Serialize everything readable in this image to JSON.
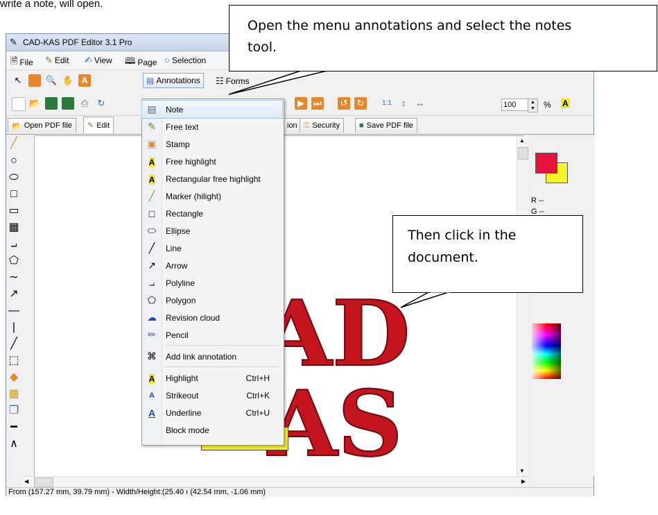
{
  "intro_text": "write a note,  will open.",
  "window": {
    "title": "CAD-KAS PDF Editor 3.1 Pro",
    "menu": [
      "File",
      "Edit",
      "View",
      "Page",
      "Selection"
    ]
  },
  "toolbar": {
    "annotations_label": "Annotations",
    "forms_label": "Forms",
    "zoom_value": "100",
    "zoom_unit": "%"
  },
  "tabs": [
    {
      "label": "Open PDF file"
    },
    {
      "label": "Edit"
    },
    {
      "label": "Security"
    },
    {
      "label": "Save PDF file"
    }
  ],
  "annotations_menu": [
    {
      "label": "Note",
      "icon": "note-icon",
      "shortcut": "",
      "highlighted": true
    },
    {
      "label": "Free text",
      "icon": "pen-icon",
      "shortcut": ""
    },
    {
      "label": "Stamp",
      "icon": "stamp-icon",
      "shortcut": ""
    },
    {
      "label": "Free highlight",
      "icon": "highlight-a-icon",
      "shortcut": ""
    },
    {
      "label": "Rectangular free highlight",
      "icon": "highlight-a-icon",
      "shortcut": ""
    },
    {
      "label": "Marker (hilight)",
      "icon": "marker-icon",
      "shortcut": ""
    },
    {
      "label": "Rectangle",
      "icon": "rectangle-icon",
      "shortcut": ""
    },
    {
      "label": "Ellipse",
      "icon": "ellipse-icon",
      "shortcut": ""
    },
    {
      "label": "Line",
      "icon": "line-icon",
      "shortcut": ""
    },
    {
      "label": "Arrow",
      "icon": "arrow-icon",
      "shortcut": ""
    },
    {
      "label": "Polyline",
      "icon": "polyline-icon",
      "shortcut": ""
    },
    {
      "label": "Polygon",
      "icon": "polygon-icon",
      "shortcut": ""
    },
    {
      "label": "Revision cloud",
      "icon": "cloud-icon",
      "shortcut": ""
    },
    {
      "label": "Pencil",
      "icon": "pencil-icon",
      "shortcut": ""
    },
    {
      "label": "Add link annotation",
      "icon": "link-icon",
      "shortcut": ""
    },
    {
      "label": "Highlight",
      "icon": "highlight-a-icon",
      "shortcut": "Ctrl+H"
    },
    {
      "label": "Strikeout",
      "icon": "strikeout-icon",
      "shortcut": "Ctrl+K"
    },
    {
      "label": "Underline",
      "icon": "underline-icon",
      "shortcut": "Ctrl+U"
    },
    {
      "label": "Block mode",
      "icon": "",
      "shortcut": ""
    }
  ],
  "callouts": {
    "top_line1": "Open the menu annotations and select the notes",
    "top_line2": "tool.",
    "side_line1": "Then click in the",
    "side_line2": "document."
  },
  "color_panel": {
    "r_label": "R --",
    "g_label": "G --",
    "foreground_color": "#e2133e",
    "background_color": "#f6f22a"
  },
  "document": {
    "logo_text_top": "AD",
    "logo_text_bottom": "AS"
  },
  "status": {
    "text": "From (157.27 mm, 39.79 mm) - Width/Height:(25.40 ı (42.54 mm, -1.06 mm)"
  }
}
